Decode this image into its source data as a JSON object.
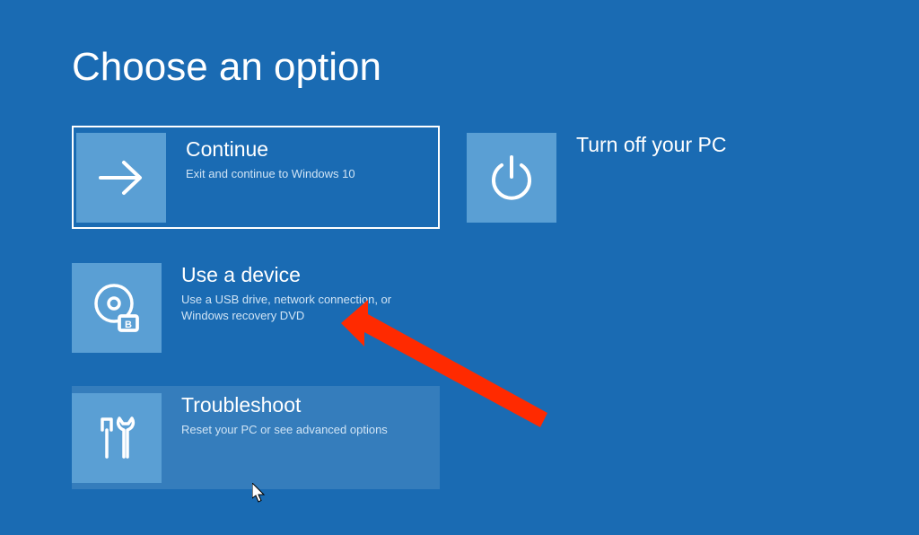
{
  "page": {
    "title": "Choose an option"
  },
  "options": {
    "continue": {
      "title": "Continue",
      "desc": "Exit and continue to Windows 10"
    },
    "turnoff": {
      "title": "Turn off your PC",
      "desc": ""
    },
    "device": {
      "title": "Use a device",
      "desc": "Use a USB drive, network connection, or Windows recovery DVD"
    },
    "troubleshoot": {
      "title": "Troubleshoot",
      "desc": "Reset your PC or see advanced options"
    }
  }
}
